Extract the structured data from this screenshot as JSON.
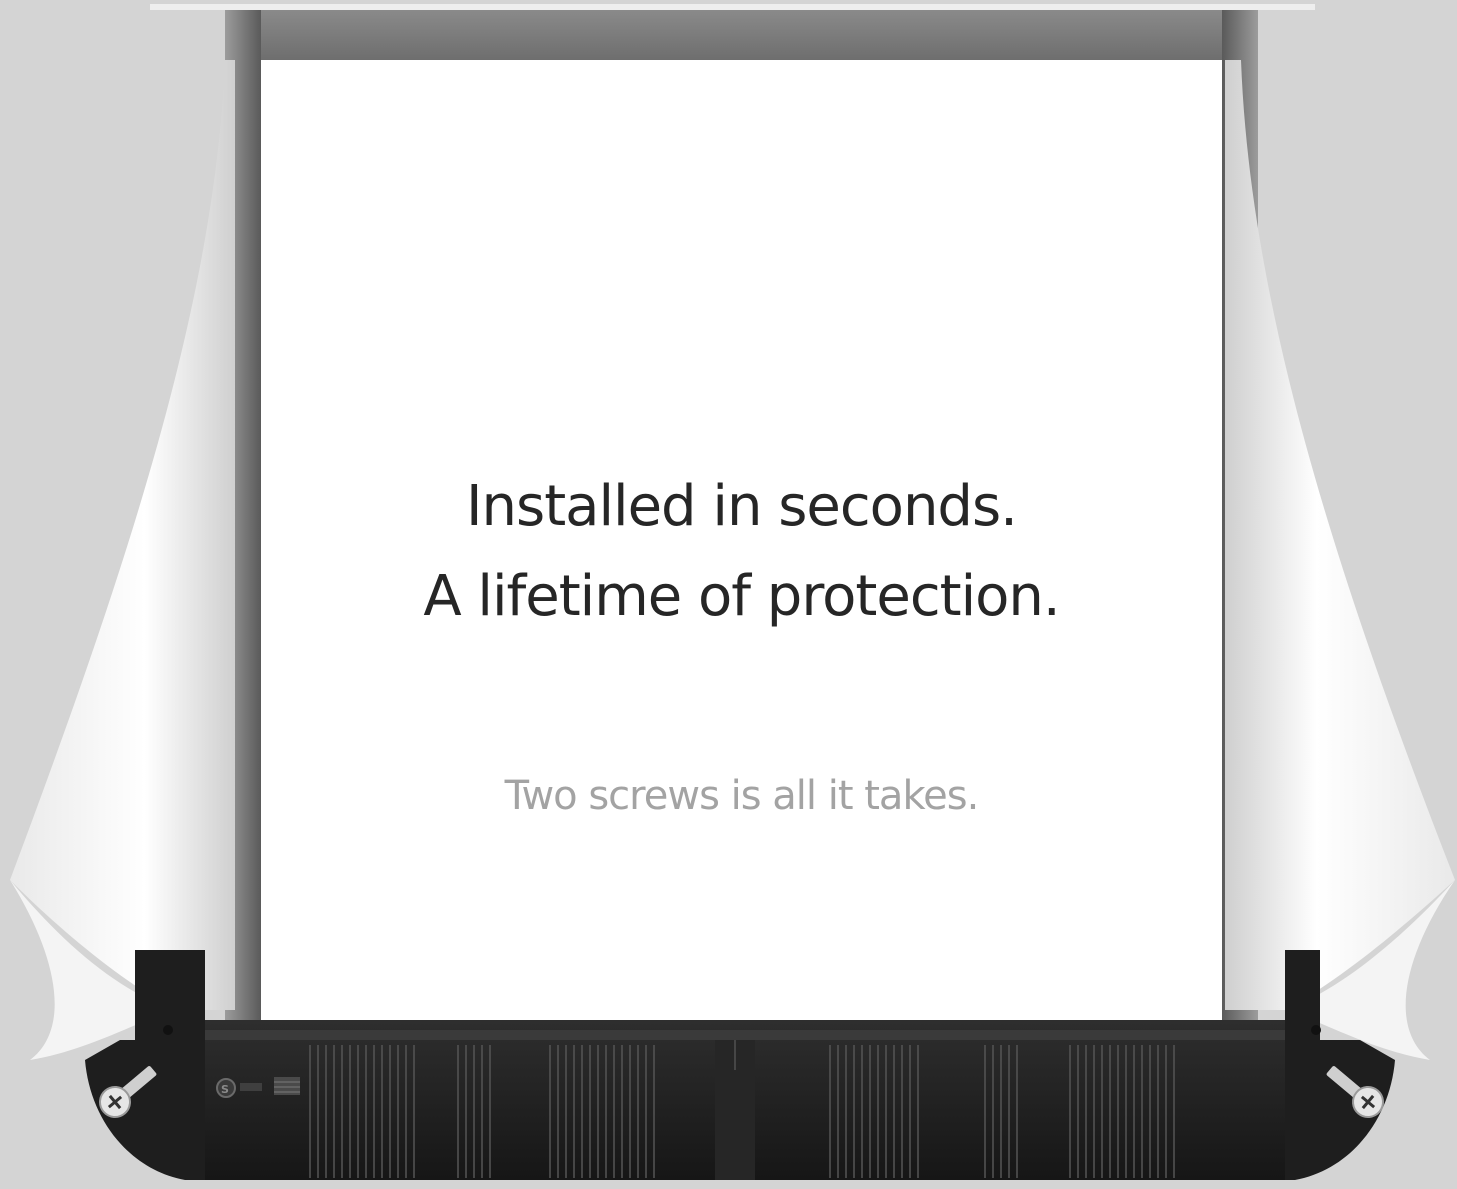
{
  "hero": {
    "headline_line1": "Installed in seconds.",
    "headline_line2": "A lifetime of protection.",
    "subheadline": "Two screws is all it takes."
  },
  "icons": {
    "left_screw": "screw-icon",
    "right_screw": "screw-icon",
    "brand_logo": "brand-logo-icon",
    "flag_badge": "flag-icon"
  },
  "colors": {
    "background": "#d4d4d4",
    "panel": "#ffffff",
    "headline": "#262626",
    "subheadline": "#a3a3a3",
    "base": "#1f1f1f"
  }
}
